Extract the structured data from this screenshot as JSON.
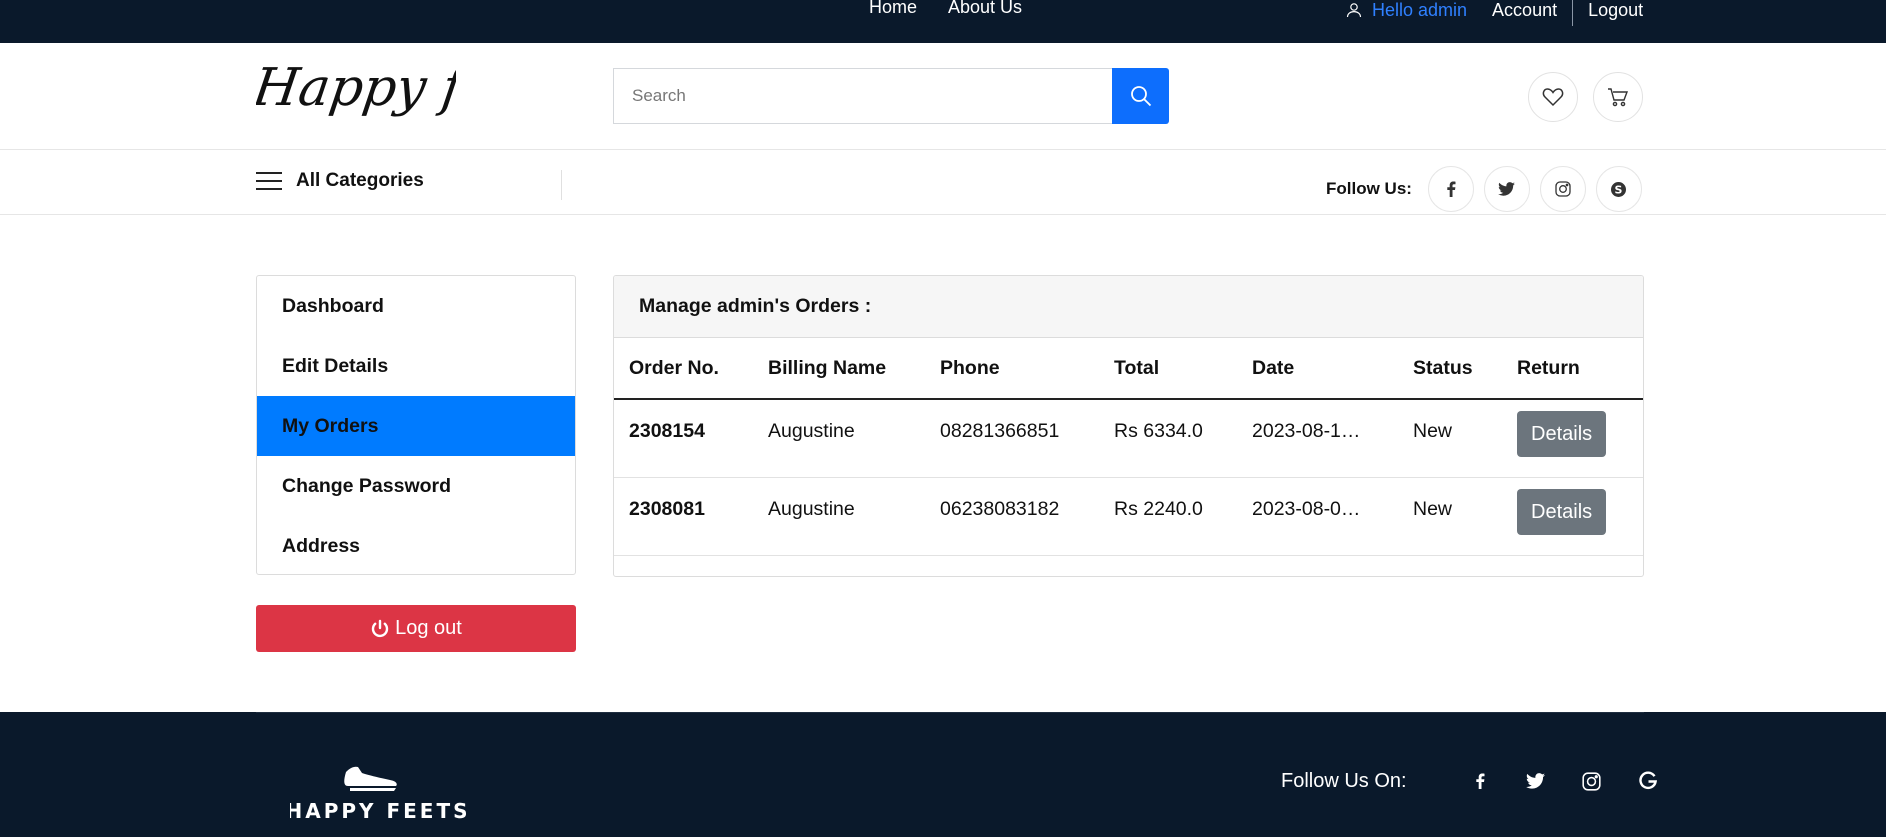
{
  "topbar": {
    "nav": [
      "Home",
      "About Us"
    ],
    "greeting": "Hello admin",
    "account": "Account",
    "logout": "Logout"
  },
  "header": {
    "logo_text": "Happy feets",
    "search_placeholder": "Search",
    "icons": [
      "heart-icon",
      "cart-icon"
    ]
  },
  "catbar": {
    "all_categories": "All Categories",
    "follow_label": "Follow Us:",
    "socials": [
      "facebook-icon",
      "twitter-icon",
      "instagram-icon",
      "skype-icon"
    ]
  },
  "sidebar": {
    "items": [
      "Dashboard",
      "Edit Details",
      "My Orders",
      "Change Password",
      "Address"
    ],
    "active": "My Orders",
    "logout_label": "Log out"
  },
  "orders": {
    "title": "Manage admin's Orders :",
    "columns": [
      "Order No.",
      "Billing Name",
      "Phone",
      "Total",
      "Date",
      "Status",
      "Return"
    ],
    "rows": [
      {
        "order_no": "2308154",
        "name": "Augustine",
        "phone": "08281366851",
        "total": "Rs 6334.0",
        "date": "2023-08-1…",
        "status": "New",
        "action": "Details"
      },
      {
        "order_no": "2308081",
        "name": "Augustine",
        "phone": "06238083182",
        "total": "Rs 2240.0",
        "date": "2023-08-0…",
        "status": "New",
        "action": "Details"
      }
    ]
  },
  "footer": {
    "brand": "HAPPY FEETS",
    "follow_label": "Follow Us On:",
    "socials": [
      "facebook-icon",
      "twitter-icon",
      "instagram-icon",
      "google-icon"
    ]
  },
  "colors": {
    "dark_bg": "#0a192b",
    "primary": "#0d6efd",
    "active_menu": "#007bff",
    "danger": "#dc3545",
    "secondary": "#6c757d"
  }
}
